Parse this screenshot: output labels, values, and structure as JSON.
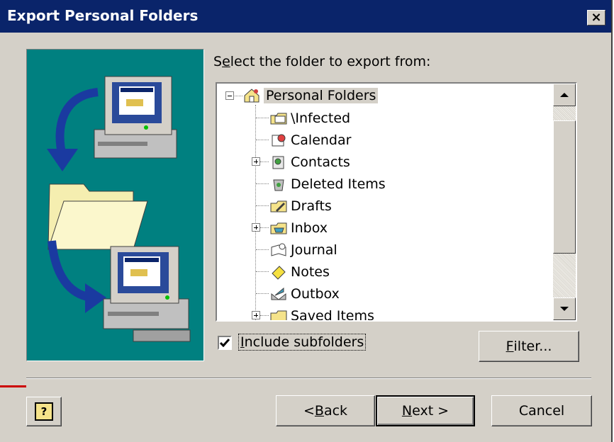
{
  "window": {
    "title": "Export Personal Folders",
    "close_glyph": "×"
  },
  "prompt": {
    "pre": "S",
    "accel": "e",
    "post": "lect the folder to export from:"
  },
  "tree": {
    "root": {
      "label": "Personal Folders",
      "icon": "personal-folders-icon"
    },
    "items": [
      {
        "label": "\\Infected",
        "icon": "mail-folder-icon",
        "expander": ""
      },
      {
        "label": "Calendar",
        "icon": "calendar-icon",
        "expander": ""
      },
      {
        "label": "Contacts",
        "icon": "contacts-icon",
        "expander": "plus"
      },
      {
        "label": "Deleted Items",
        "icon": "deleted-items-icon",
        "expander": ""
      },
      {
        "label": "Drafts",
        "icon": "drafts-icon",
        "expander": ""
      },
      {
        "label": "Inbox",
        "icon": "inbox-icon",
        "expander": "plus"
      },
      {
        "label": "Journal",
        "icon": "journal-icon",
        "expander": ""
      },
      {
        "label": "Notes",
        "icon": "notes-icon",
        "expander": ""
      },
      {
        "label": "Outbox",
        "icon": "outbox-icon",
        "expander": ""
      },
      {
        "label": "Saved Items",
        "icon": "saved-items-icon",
        "expander": "plus"
      }
    ]
  },
  "include_subfolders": {
    "checked": true,
    "pre": "",
    "accel": "I",
    "post": "nclude subfolders"
  },
  "buttons": {
    "filter": {
      "pre": "",
      "accel": "F",
      "post": "ilter..."
    },
    "back": {
      "pre": "< ",
      "accel": "B",
      "post": "ack"
    },
    "next": {
      "pre": "",
      "accel": "N",
      "post": "ext >"
    },
    "cancel": {
      "label": "Cancel"
    },
    "help": {
      "glyph": "?"
    }
  },
  "colors": {
    "title_bar": "#0a246a",
    "art_background": "#008080",
    "dialog_face": "#d4d0c8"
  }
}
